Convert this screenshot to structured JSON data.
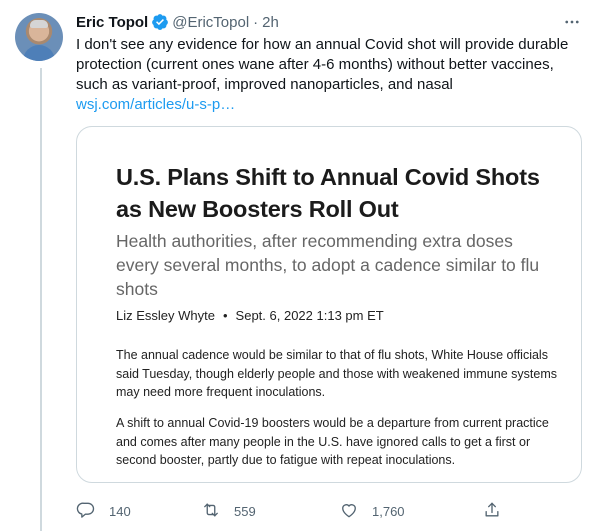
{
  "author": {
    "name": "Eric Topol",
    "handle": "@EricTopol",
    "separator": "·",
    "time": "2h"
  },
  "tweet": {
    "text": "I don't see any evidence for how an annual Covid shot will provide durable protection (current ones wane after 4-6 months) without better vaccines, such as variant-proof, improved nanoparticles, and nasal",
    "link": "wsj.com/articles/u-s-p…"
  },
  "card": {
    "headline": "U.S. Plans Shift to Annual Covid Shots as New Boosters Roll Out",
    "dek": "Health authorities, after recommending extra doses every several months, to adopt a cadence similar to flu shots",
    "author": "Liz Essley Whyte",
    "byline_dot": "•",
    "date": "Sept. 6, 2022 1:13 pm ET",
    "paragraph1": "The annual cadence would be similar to that of flu shots, White House officials said Tuesday, though elderly people and those with weakened immune systems may need more frequent inoculations.",
    "paragraph2": "A shift to annual Covid-19 boosters would be a departure from current practice and comes after many people in the U.S. have ignored calls to get a first or second booster, partly due to fatigue with repeat inoculations."
  },
  "actions": {
    "replies": "140",
    "retweets": "559",
    "likes": "1,760"
  },
  "icons": {
    "verified": "verified-badge-icon",
    "more": "more-icon",
    "reply": "reply-icon",
    "retweet": "retweet-icon",
    "like": "heart-icon",
    "share": "share-icon"
  },
  "colors": {
    "accent": "#1d9bf0",
    "secondary_text": "#536471",
    "border": "#cfd9de"
  }
}
